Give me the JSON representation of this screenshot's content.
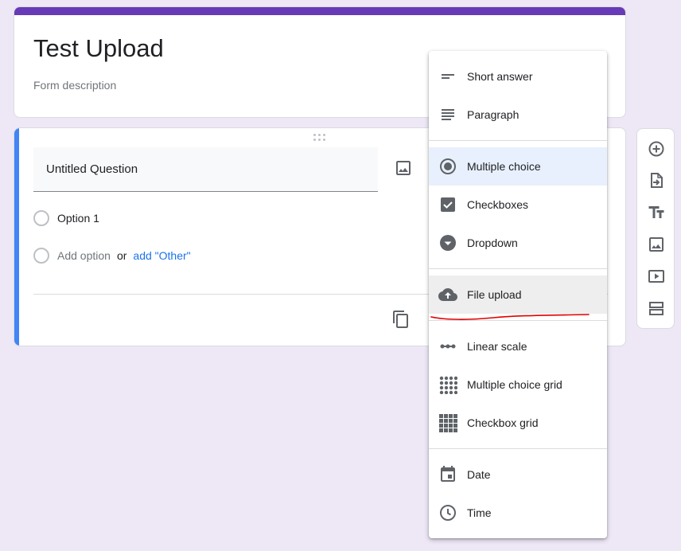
{
  "form": {
    "title": "Test Upload",
    "description": "Form description"
  },
  "question": {
    "title": "Untitled Question",
    "options": [
      "Option 1"
    ],
    "add_option": "Add option",
    "or_text": "or",
    "add_other": "add \"Other\""
  },
  "menu": {
    "items": [
      {
        "label": "Short answer",
        "icon": "short-answer-icon"
      },
      {
        "label": "Paragraph",
        "icon": "paragraph-icon"
      },
      {
        "label": "Multiple choice",
        "icon": "radio-button-icon",
        "selected": true
      },
      {
        "label": "Checkboxes",
        "icon": "checkbox-icon"
      },
      {
        "label": "Dropdown",
        "icon": "dropdown-icon"
      },
      {
        "label": "File upload",
        "icon": "cloud-upload-icon",
        "highlighted": true
      },
      {
        "label": "Linear scale",
        "icon": "linear-scale-icon"
      },
      {
        "label": "Multiple choice grid",
        "icon": "dot-grid-icon"
      },
      {
        "label": "Checkbox grid",
        "icon": "checkbox-grid-icon"
      },
      {
        "label": "Date",
        "icon": "calendar-icon"
      },
      {
        "label": "Time",
        "icon": "clock-icon"
      }
    ]
  },
  "side_toolbar": {
    "buttons": [
      "add-question-icon",
      "import-questions-icon",
      "add-title-icon",
      "add-image-icon",
      "add-video-icon",
      "add-section-icon"
    ]
  },
  "colors": {
    "accent": "#673ab7",
    "active_question": "#4285f4",
    "background": "#ede7f6",
    "link": "#1a73e8",
    "annotation": "#e00000"
  }
}
